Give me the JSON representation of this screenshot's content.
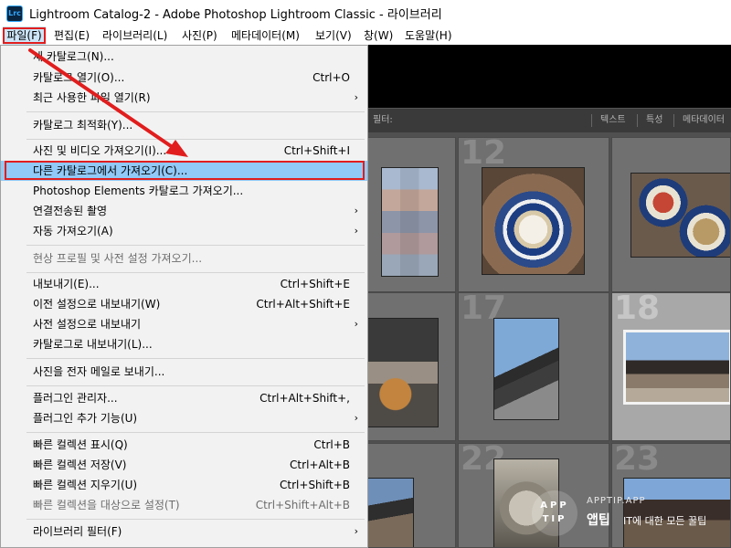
{
  "window": {
    "title": "Lightroom Catalog-2 - Adobe Photoshop Lightroom Classic - 라이브러리",
    "logo": "Lrc"
  },
  "menubar": [
    "파일(F)",
    "편집(E)",
    "라이브러리(L)",
    "사진(P)",
    "메타데이터(M)",
    "보기(V)",
    "창(W)",
    "도움말(H)"
  ],
  "file_menu": {
    "items": [
      {
        "label": "새 카탈로그(N)...",
        "shortcut": "",
        "submenu": false,
        "disabled": false
      },
      {
        "label": "카탈로그 열기(O)...",
        "shortcut": "Ctrl+O",
        "submenu": false,
        "disabled": false
      },
      {
        "label": "최근 사용한 파일 열기(R)",
        "shortcut": "",
        "submenu": true,
        "disabled": false
      },
      {
        "label": "카탈로그 최적화(Y)...",
        "shortcut": "",
        "submenu": false,
        "disabled": false
      },
      {
        "label": "사진 및 비디오 가져오기(I)...",
        "shortcut": "Ctrl+Shift+I",
        "submenu": false,
        "disabled": false
      },
      {
        "label": "다른 카탈로그에서 가져오기(C)...",
        "shortcut": "",
        "submenu": false,
        "disabled": false,
        "highlighted": true
      },
      {
        "label": "Photoshop Elements 카탈로그 가져오기...",
        "shortcut": "",
        "submenu": false,
        "disabled": false
      },
      {
        "label": "연결전송된 촬영",
        "shortcut": "",
        "submenu": true,
        "disabled": false
      },
      {
        "label": "자동 가져오기(A)",
        "shortcut": "",
        "submenu": true,
        "disabled": false
      },
      {
        "label": "현상 프로필 및 사전 설정 가져오기...",
        "shortcut": "",
        "submenu": false,
        "disabled": true
      },
      {
        "label": "내보내기(E)...",
        "shortcut": "Ctrl+Shift+E",
        "submenu": false,
        "disabled": false
      },
      {
        "label": "이전 설정으로 내보내기(W)",
        "shortcut": "Ctrl+Alt+Shift+E",
        "submenu": false,
        "disabled": false
      },
      {
        "label": "사전 설정으로 내보내기",
        "shortcut": "",
        "submenu": true,
        "disabled": false
      },
      {
        "label": "카탈로그로 내보내기(L)...",
        "shortcut": "",
        "submenu": false,
        "disabled": false
      },
      {
        "label": "사진을 전자 메일로 보내기...",
        "shortcut": "",
        "submenu": false,
        "disabled": false
      },
      {
        "label": "플러그인 관리자...",
        "shortcut": "Ctrl+Alt+Shift+,",
        "submenu": false,
        "disabled": false
      },
      {
        "label": "플러그인 추가 기능(U)",
        "shortcut": "",
        "submenu": true,
        "disabled": false
      },
      {
        "label": "빠른 컬렉션 표시(Q)",
        "shortcut": "Ctrl+B",
        "submenu": false,
        "disabled": false
      },
      {
        "label": "빠른 컬렉션 저장(V)",
        "shortcut": "Ctrl+Alt+B",
        "submenu": false,
        "disabled": false
      },
      {
        "label": "빠른 컬렉션 지우기(U)",
        "shortcut": "Ctrl+Shift+B",
        "submenu": false,
        "disabled": false
      },
      {
        "label": "빠른 컬렉션을 대상으로 설정(T)",
        "shortcut": "Ctrl+Shift+Alt+B",
        "submenu": false,
        "disabled": true
      },
      {
        "label": "라이브러리 필터(F)",
        "shortcut": "",
        "submenu": true,
        "disabled": false
      }
    ],
    "submenu_arrow": "›"
  },
  "filter_bar": {
    "label": "필터:",
    "tabs": [
      "텍스트",
      "특성",
      "메타데이터"
    ]
  },
  "grid": {
    "cells": [
      "",
      "12",
      "",
      "",
      "17",
      "18",
      "",
      "22",
      "23"
    ]
  },
  "watermark": {
    "circle": "APP TIP",
    "top": "APPTIP.APP",
    "brand": "앱팁",
    "tagline": "IT에 대한 모든 꿀팁"
  },
  "colors": {
    "menu_bg": "#f2f2f2",
    "highlight": "#91c9f7",
    "annotation_red": "#e11d1d",
    "menubar_active": "#cce4f7"
  }
}
